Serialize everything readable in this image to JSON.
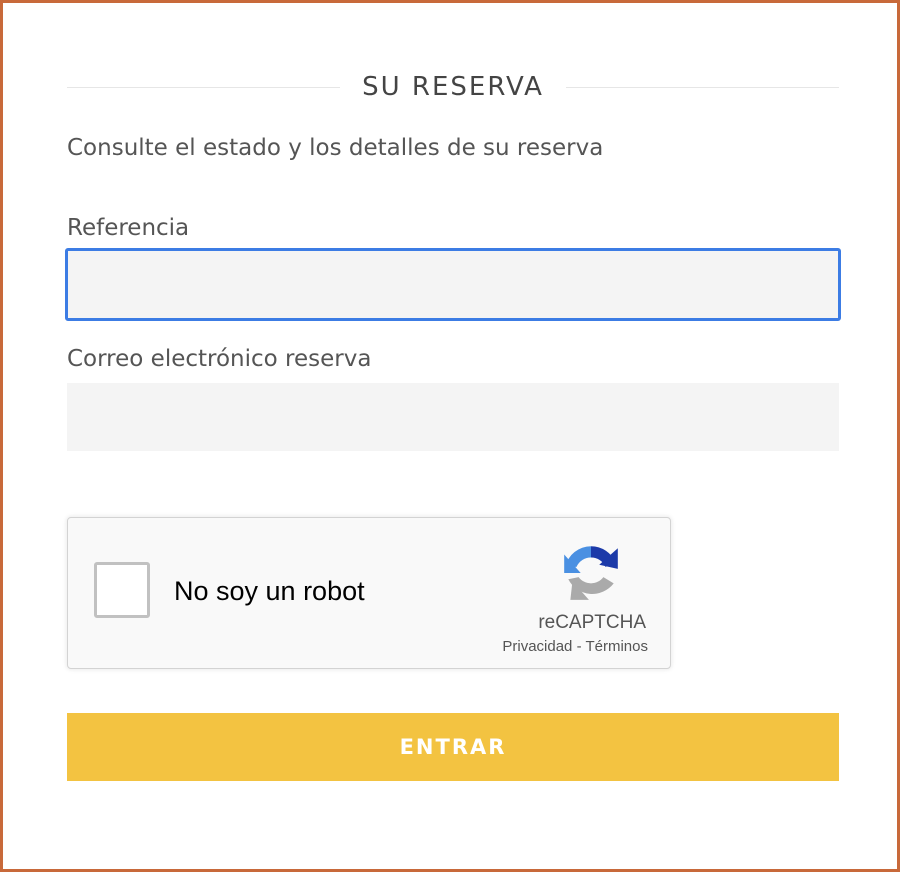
{
  "header": {
    "title": "SU RESERVA",
    "subtitle": "Consulte el estado y los detalles de su reserva"
  },
  "form": {
    "reference": {
      "label": "Referencia",
      "value": "",
      "placeholder": ""
    },
    "email": {
      "label": "Correo electrónico reserva",
      "value": "",
      "placeholder": ""
    },
    "submit_label": "ENTRAR"
  },
  "recaptcha": {
    "checkbox_label": "No soy un robot",
    "brand": "reCAPTCHA",
    "privacy_link": "Privacidad",
    "separator": "-",
    "terms_link": "Términos",
    "icon": "recaptcha-logo-icon",
    "checked": false
  },
  "colors": {
    "border_frame": "#c8693a",
    "input_focus": "#3c7ce4",
    "input_bg": "#f4f4f4",
    "button_bg": "#f3c341",
    "button_text": "#ffffff"
  }
}
